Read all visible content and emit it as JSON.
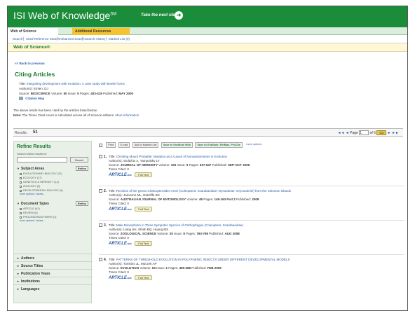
{
  "header": {
    "logo_text": "ISI Web of Knowledge",
    "logo_tm": "SM",
    "tagline": "Take the next step"
  },
  "tabs": [
    {
      "label": "Web of Science"
    },
    {
      "label": "Additional Resources"
    }
  ],
  "subnav": [
    "Search",
    "Cited Reference Search",
    "Advanced Search",
    "Search History",
    "Marked List (0)"
  ],
  "section_bar": "Web of Science®",
  "back_link": "<< Back to previous",
  "page_title": "Citing Articles",
  "source_record": {
    "title_label": "Title:",
    "title": "Integrating development with evolution: A case study with beetle horns",
    "authors_label": "Author(s):",
    "authors": "Emlen, DJ",
    "source_label": "Source:",
    "source": "BIOSCIENCE",
    "volume_label": "Volume:",
    "volume": "50",
    "issue_label": "Issue:",
    "issue": "5",
    "pages_label": "Pages:",
    "pages": "403-418",
    "published_label": "Published:",
    "published": "MAY 2000",
    "citation_map": "Citation Map"
  },
  "notes": {
    "line1": "The above article has been cited by the articles listed below.",
    "line2_bold": "Note:",
    "line2": "The Times Cited count is calculated across all of Science editions.",
    "more_info": "More information"
  },
  "results": {
    "label": "Results:",
    "count": "51",
    "page_label": "Page",
    "page_value": "1",
    "of_label": "of 6",
    "go": "Go",
    "prev": "◄◄ ◄",
    "next": "► ►►"
  },
  "sidebar": {
    "title": "Refine Results",
    "hint": "Search within results for",
    "search_button": "Search",
    "subject_areas": {
      "label": "Subject Areas",
      "refine": "Refine",
      "options": [
        "EVOLUTIONARY BIOLOGY (22)",
        "ECOLOGY (17)",
        "GENETICS & HEREDITY (12)",
        "ZOOLOGY (9)",
        "DEVELOPMENTAL BIOLOGY (6)"
      ],
      "more": "more options / values..."
    },
    "document_types": {
      "label": "Document Types",
      "refine": "Refine",
      "options": [
        "ARTICLE (42)",
        "REVIEW (8)",
        "PROCEEDINGS PAPER (1)"
      ],
      "more": "more options / values..."
    },
    "collapsed": [
      "Authors",
      "Source Titles",
      "Publication Years",
      "Institutions",
      "Languages"
    ]
  },
  "toolbar": {
    "buttons": [
      "Print",
      "E-mail",
      "Add to Marked List",
      "Save to EndNote Web",
      "Save to EndNote, RefMan, ProCite",
      "more options"
    ]
  },
  "records": [
    {
      "num": "1.",
      "title": "Climbing Mount Probable: Mutation as a Cause of Nonrandomness in Evolution",
      "authors": "Stoltzfus A, Yampolsky LY",
      "source": "JOURNAL OF HEREDITY",
      "volume": "100",
      "issue": "5",
      "pages": "637-647",
      "published": "SEP-OCT 2009",
      "times_cited": "Times Cited: 0"
    },
    {
      "num": "2.",
      "title": "Revision of the genus Chalcopteroides Amm (Coleoptera: Scarabaeidae: Dynastinae: Oryctoderini) from the Solomon Islands",
      "authors": "Jameson ML, Ratcliffe BC",
      "source": "AUSTRALIAN JOURNAL OF ENTOMOLOGY",
      "volume": "48",
      "issue": "",
      "pages": "149-163",
      "part": "Part 2",
      "published": "2009",
      "times_cited": "Times Cited: 0"
    },
    {
      "num": "3.",
      "title": "Male Dimorphism in Three Sympatric Species of Onthophagus (Coleoptera: Scarabaeidae)",
      "authors": "Liang SH, Shiah BQ, Huang MS",
      "source": "ZOOLOGICAL SCIENCE",
      "volume": "25",
      "issue": "8",
      "pages": "793-798",
      "published": "AUG 2008",
      "times_cited": "Times Cited: 0"
    },
    {
      "num": "4.",
      "title": "PATTERNS OF THRESHOLD EVOLUTION IN POLYPHENIC INSECTS UNDER DIFFERENT DEVELOPMENTAL MODELS",
      "authors": "Tomkins JL, Moczek AP",
      "source": "EVOLUTION",
      "volume": "63",
      "issue": "2",
      "pages": "459-468",
      "published": "FEB 2009",
      "times_cited": "Times Cited: 0"
    }
  ],
  "record_labels": {
    "title": "Title:",
    "authors": "Author(s):",
    "source": "Source:",
    "volume": "Volume:",
    "issue": "Issue:",
    "pages": "Pages:",
    "published": "Published:",
    "full_text": "Full Text",
    "article_logo": "ARTICLE",
    "article_logo_sub": "LINK"
  },
  "colors": {
    "brand_green": "#1a8c3a",
    "link_blue": "#2a5aa8",
    "tab_yellow": "#f4c430"
  }
}
